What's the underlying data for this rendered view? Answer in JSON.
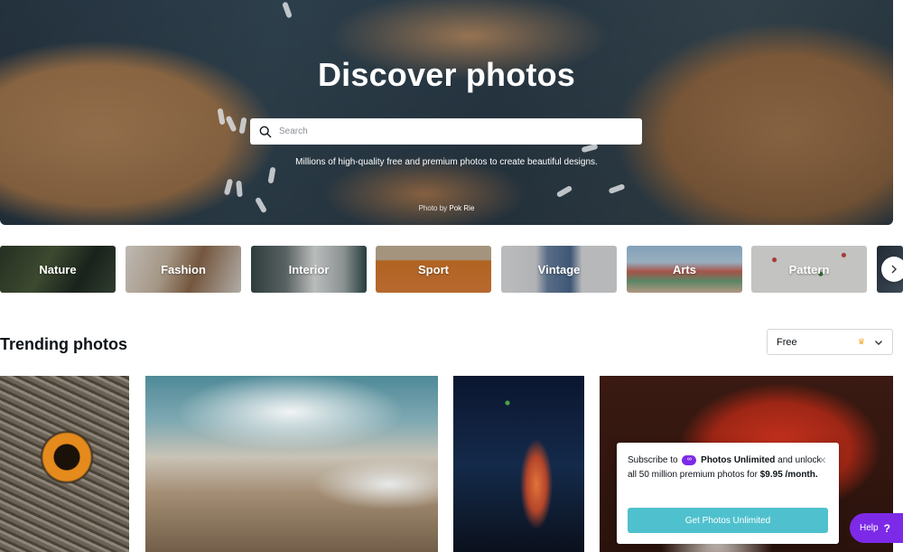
{
  "hero": {
    "title": "Discover photos",
    "search_placeholder": "Search",
    "subtitle": "Millions of high-quality free and premium photos to create beautiful designs.",
    "credit_prefix": "Photo by",
    "credit_author": "Pok Rie"
  },
  "categories": [
    {
      "label": "Nature"
    },
    {
      "label": "Fashion"
    },
    {
      "label": "Interior"
    },
    {
      "label": "Sport"
    },
    {
      "label": "Vintage"
    },
    {
      "label": "Arts"
    },
    {
      "label": "Pattern"
    }
  ],
  "trending": {
    "title": "Trending photos",
    "filter_value": "Free",
    "photos": [
      "owl",
      "mountains",
      "singer",
      "red-hair"
    ]
  },
  "promo": {
    "text_prefix": "Subscribe to",
    "brand": "Photos Unlimited",
    "text_suffix": "and unlock all 50 million premium photos for",
    "price": "$9.95 /month.",
    "button_label": "Get Photos Unlimited",
    "close_symbol": "×"
  },
  "help": {
    "label": "Help",
    "symbol": "?"
  },
  "colors": {
    "accent_purple": "#7d2ae8",
    "promo_button": "#4fc1ce",
    "crown": "#f5a623"
  },
  "icons": [
    "search-icon",
    "chevron-right-icon",
    "crown-icon",
    "chevron-down-icon",
    "infinity-icon",
    "close-icon"
  ]
}
